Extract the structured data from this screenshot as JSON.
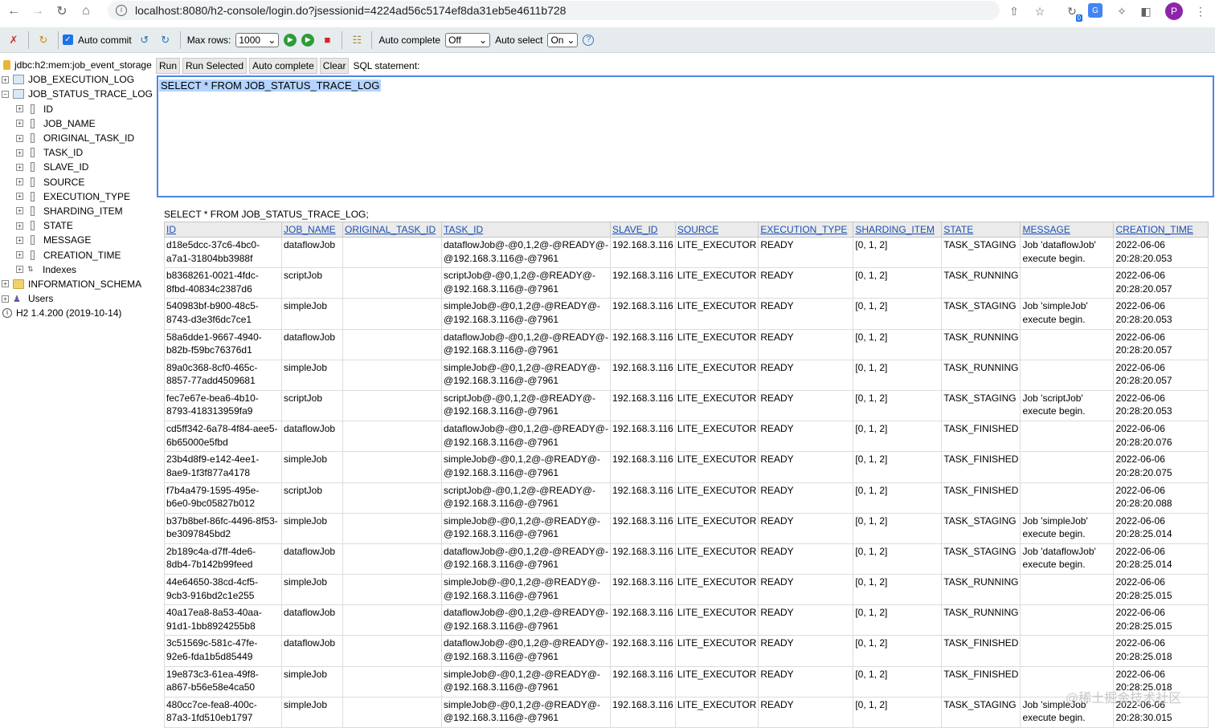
{
  "browser": {
    "url": "localhost:8080/h2-console/login.do?jsessionid=4224ad56c5174ef8da31eb5e4611b728",
    "avatar_letter": "P",
    "badge_count": "0"
  },
  "toolbar": {
    "auto_commit_label": "Auto commit",
    "max_rows_label": "Max rows:",
    "max_rows_value": "1000",
    "auto_complete_label": "Auto complete",
    "auto_complete_value": "Off",
    "auto_select_label": "Auto select",
    "auto_select_value": "On",
    "help_symbol": "?"
  },
  "tree": {
    "connection": "jdbc:h2:mem:job_event_storage",
    "table1": "JOB_EXECUTION_LOG",
    "table2": "JOB_STATUS_TRACE_LOG",
    "columns": [
      "ID",
      "JOB_NAME",
      "ORIGINAL_TASK_ID",
      "TASK_ID",
      "SLAVE_ID",
      "SOURCE",
      "EXECUTION_TYPE",
      "SHARDING_ITEM",
      "STATE",
      "MESSAGE",
      "CREATION_TIME"
    ],
    "indexes": "Indexes",
    "info_schema": "INFORMATION_SCHEMA",
    "users": "Users",
    "version": "H2 1.4.200 (2019-10-14)"
  },
  "query": {
    "run": "Run",
    "run_selected": "Run Selected",
    "auto_complete": "Auto complete",
    "clear": "Clear",
    "sql_label": "SQL statement:",
    "sql_text": "SELECT * FROM JOB_STATUS_TRACE_LOG"
  },
  "result": {
    "header": "SELECT * FROM JOB_STATUS_TRACE_LOG;",
    "columns": [
      "ID",
      "JOB_NAME",
      "ORIGINAL_TASK_ID",
      "TASK_ID",
      "SLAVE_ID",
      "SOURCE",
      "EXECUTION_TYPE",
      "SHARDING_ITEM",
      "STATE",
      "MESSAGE",
      "CREATION_TIME"
    ],
    "rows": [
      [
        "d18e5dcc-37c6-4bc0-a7a1-31804bb3988f",
        "dataflowJob",
        "",
        "dataflowJob@-@0,1,2@-@READY@-@192.168.3.116@-@7961",
        "192.168.3.116",
        "LITE_EXECUTOR",
        "READY",
        "[0, 1, 2]",
        "TASK_STAGING",
        "Job 'dataflowJob' execute begin.",
        "2022-06-06 20:28:20.053"
      ],
      [
        "b8368261-0021-4fdc-8fbd-40834c2387d6",
        "scriptJob",
        "",
        "scriptJob@-@0,1,2@-@READY@-@192.168.3.116@-@7961",
        "192.168.3.116",
        "LITE_EXECUTOR",
        "READY",
        "[0, 1, 2]",
        "TASK_RUNNING",
        "",
        "2022-06-06 20:28:20.057"
      ],
      [
        "540983bf-b900-48c5-8743-d3e3f6dc7ce1",
        "simpleJob",
        "",
        "simpleJob@-@0,1,2@-@READY@-@192.168.3.116@-@7961",
        "192.168.3.116",
        "LITE_EXECUTOR",
        "READY",
        "[0, 1, 2]",
        "TASK_STAGING",
        "Job 'simpleJob' execute begin.",
        "2022-06-06 20:28:20.053"
      ],
      [
        "58a6dde1-9667-4940-b82b-f59bc76376d1",
        "dataflowJob",
        "",
        "dataflowJob@-@0,1,2@-@READY@-@192.168.3.116@-@7961",
        "192.168.3.116",
        "LITE_EXECUTOR",
        "READY",
        "[0, 1, 2]",
        "TASK_RUNNING",
        "",
        "2022-06-06 20:28:20.057"
      ],
      [
        "89a0c368-8cf0-465c-8857-77add4509681",
        "simpleJob",
        "",
        "simpleJob@-@0,1,2@-@READY@-@192.168.3.116@-@7961",
        "192.168.3.116",
        "LITE_EXECUTOR",
        "READY",
        "[0, 1, 2]",
        "TASK_RUNNING",
        "",
        "2022-06-06 20:28:20.057"
      ],
      [
        "fec7e67e-bea6-4b10-8793-418313959fa9",
        "scriptJob",
        "",
        "scriptJob@-@0,1,2@-@READY@-@192.168.3.116@-@7961",
        "192.168.3.116",
        "LITE_EXECUTOR",
        "READY",
        "[0, 1, 2]",
        "TASK_STAGING",
        "Job 'scriptJob' execute begin.",
        "2022-06-06 20:28:20.053"
      ],
      [
        "cd5ff342-6a78-4f84-aee5-6b65000e5fbd",
        "dataflowJob",
        "",
        "dataflowJob@-@0,1,2@-@READY@-@192.168.3.116@-@7961",
        "192.168.3.116",
        "LITE_EXECUTOR",
        "READY",
        "[0, 1, 2]",
        "TASK_FINISHED",
        "",
        "2022-06-06 20:28:20.076"
      ],
      [
        "23b4d8f9-e142-4ee1-8ae9-1f3f877a4178",
        "simpleJob",
        "",
        "simpleJob@-@0,1,2@-@READY@-@192.168.3.116@-@7961",
        "192.168.3.116",
        "LITE_EXECUTOR",
        "READY",
        "[0, 1, 2]",
        "TASK_FINISHED",
        "",
        "2022-06-06 20:28:20.075"
      ],
      [
        "f7b4a479-1595-495e-b6e0-9bc05827b012",
        "scriptJob",
        "",
        "scriptJob@-@0,1,2@-@READY@-@192.168.3.116@-@7961",
        "192.168.3.116",
        "LITE_EXECUTOR",
        "READY",
        "[0, 1, 2]",
        "TASK_FINISHED",
        "",
        "2022-06-06 20:28:20.088"
      ],
      [
        "b37b8bef-86fc-4496-8f53-be3097845bd2",
        "simpleJob",
        "",
        "simpleJob@-@0,1,2@-@READY@-@192.168.3.116@-@7961",
        "192.168.3.116",
        "LITE_EXECUTOR",
        "READY",
        "[0, 1, 2]",
        "TASK_STAGING",
        "Job 'simpleJob' execute begin.",
        "2022-06-06 20:28:25.014"
      ],
      [
        "2b189c4a-d7ff-4de6-8db4-7b142b99feed",
        "dataflowJob",
        "",
        "dataflowJob@-@0,1,2@-@READY@-@192.168.3.116@-@7961",
        "192.168.3.116",
        "LITE_EXECUTOR",
        "READY",
        "[0, 1, 2]",
        "TASK_STAGING",
        "Job 'dataflowJob' execute begin.",
        "2022-06-06 20:28:25.014"
      ],
      [
        "44e64650-38cd-4cf5-9cb3-916bd2c1e255",
        "simpleJob",
        "",
        "simpleJob@-@0,1,2@-@READY@-@192.168.3.116@-@7961",
        "192.168.3.116",
        "LITE_EXECUTOR",
        "READY",
        "[0, 1, 2]",
        "TASK_RUNNING",
        "",
        "2022-06-06 20:28:25.015"
      ],
      [
        "40a17ea8-8a53-40aa-91d1-1bb8924255b8",
        "dataflowJob",
        "",
        "dataflowJob@-@0,1,2@-@READY@-@192.168.3.116@-@7961",
        "192.168.3.116",
        "LITE_EXECUTOR",
        "READY",
        "[0, 1, 2]",
        "TASK_RUNNING",
        "",
        "2022-06-06 20:28:25.015"
      ],
      [
        "3c51569c-581c-47fe-92e6-fda1b5d85449",
        "dataflowJob",
        "",
        "dataflowJob@-@0,1,2@-@READY@-@192.168.3.116@-@7961",
        "192.168.3.116",
        "LITE_EXECUTOR",
        "READY",
        "[0, 1, 2]",
        "TASK_FINISHED",
        "",
        "2022-06-06 20:28:25.018"
      ],
      [
        "19e873c3-61ea-49f8-a867-b56e58e4ca50",
        "simpleJob",
        "",
        "simpleJob@-@0,1,2@-@READY@-@192.168.3.116@-@7961",
        "192.168.3.116",
        "LITE_EXECUTOR",
        "READY",
        "[0, 1, 2]",
        "TASK_FINISHED",
        "",
        "2022-06-06 20:28:25.018"
      ],
      [
        "480cc7ce-fea8-400c-87a3-1fd510eb1797",
        "simpleJob",
        "",
        "simpleJob@-@0,1,2@-@READY@-@192.168.3.116@-@7961",
        "192.168.3.116",
        "LITE_EXECUTOR",
        "READY",
        "[0, 1, 2]",
        "TASK_STAGING",
        "Job 'simpleJob' execute begin.",
        "2022-06-06 20:28:30.015"
      ]
    ]
  },
  "watermark": "@稀土掘金技术社区"
}
